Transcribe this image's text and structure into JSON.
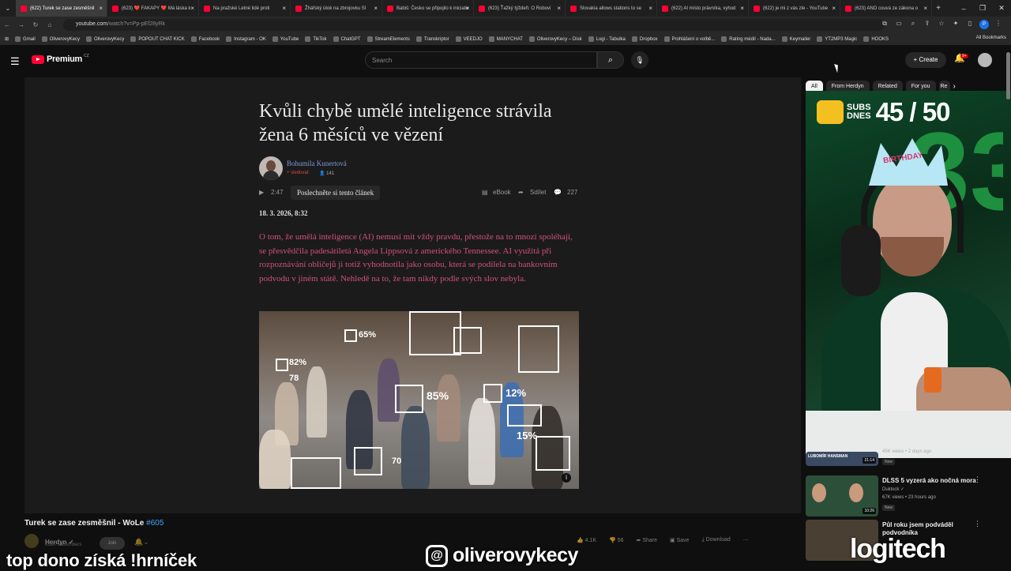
{
  "browser": {
    "tabs": [
      {
        "label": "(622) Turek se zase zesměšnil",
        "active": true
      },
      {
        "label": "(623) ❤️ FAKAPY ❤️ Má láska k",
        "active": false
      },
      {
        "label": "Na pražské Letné lidé proti",
        "active": false
      },
      {
        "label": "Žhářský útok na zbrojovku Sl",
        "active": false
      },
      {
        "label": "Babiš: Česko se připojilo k iniciativ",
        "active": false
      },
      {
        "label": "(623) Ťažký týždeň: O Robovi",
        "active": false
      },
      {
        "label": "Slovakia allows stations to se",
        "active": false
      },
      {
        "label": "(622) AI místo právníka, vyhod",
        "active": false
      },
      {
        "label": "(622) je mi z vás zle - YouTube",
        "active": false
      },
      {
        "label": "(623) ANO couvá ze zákona o",
        "active": false
      }
    ],
    "url_domain": "youtube.com",
    "url_path": "/watch?v=Pp-pEf28yRk",
    "bookmarks": [
      "Gmail",
      "OliverovyKecy",
      "OliverovyKecy",
      "POPOUT CHAT KICK",
      "Facebook",
      "Instagram - OK",
      "YouTube",
      "TikTok",
      "ChatGPT",
      "StreamElements",
      "Transkriptor",
      "VEEDJO",
      "MANYCHAT",
      "OliverovyKecy – Disk",
      "Logi - Tabulka",
      "Dropbox",
      "Prohlášení o volbě...",
      "Rating médií - Nada...",
      "Keymailer",
      "YT2MP3 Magic",
      "HOOKS"
    ],
    "all_bookmarks": "All Bookmarks",
    "profile_letter": "P"
  },
  "youtube": {
    "logo_text": "Premium",
    "logo_region": "CZ",
    "search_placeholder": "Search",
    "create_label": "Create",
    "notif_count": "9+",
    "chips": [
      "All",
      "From Herdyn",
      "Related",
      "For you",
      "Re"
    ]
  },
  "article": {
    "title": "Kvůli chybě umělé inteligence strávila žena 6 měsíců ve vězení",
    "author": "Bohumila Kunertová",
    "follow_label": "+ sledovat",
    "followers": "141",
    "audio_duration": "2:47",
    "listen_label": "Poslechněte si tento článek",
    "ebook_label": "eBook",
    "share_label": "Sdílet",
    "comments": "227",
    "date": "18. 3. 2026, 8:32",
    "lead": "O tom, že umělá inteligence (AI) nemusí mít vždy pravdu, přestože na to mnozí spoléhají, se přesvědčila padesátiletá Angela Lippsová z amerického Tennessee. AI využitá při rozpoznávání obličejů ji totiž vyhodnotila jako osobu, která se podílela na bankovním podvodu v jiném státě. Nehledě na to, že tam nikdy podle svých slov nebyla.",
    "photo_labels": [
      "65%",
      "82%",
      "78",
      "85%",
      "12%",
      "15%",
      "70"
    ],
    "photo_info": "i"
  },
  "webcam": {
    "subs_label_line1": "SUBS",
    "subs_label_line2": "DNES",
    "subs_count": "45 / 50",
    "balloon_number": "33",
    "hat_text": "BIRTHDAY"
  },
  "recommendations": [
    {
      "title": "",
      "channel": "",
      "meta": "45K views • 2 days ago",
      "new": "New",
      "duration": "21:14",
      "thumb_text": "LUBOMÍR HANSMAN",
      "thumb_color": "#3b4a63"
    },
    {
      "title": "DLSS 5 vyzerá ako nočná mora",
      "channel": "Duklock ✓",
      "meta": "67K views • 23 hours ago",
      "new": "New",
      "duration": "10:26",
      "thumb_text": "",
      "thumb_color": "#2c4f3a"
    },
    {
      "title": "Půl roku jsem podváděl podvodníka",
      "channel": "",
      "meta": "",
      "new": "",
      "duration": "",
      "thumb_text": "",
      "thumb_color": "#4a3f33"
    }
  ],
  "video": {
    "title": "Turek se zase zesměšnil - WoLe",
    "hashtag": "#605",
    "channel": "Herdyn ✓",
    "subs": "618K subscribers",
    "join_label": "Join",
    "likes": "4.1K",
    "dislike_label": "56",
    "share_label": "Share",
    "save_label": "Save",
    "download_label": "Download"
  },
  "overlay": {
    "bottom_left": "top dono získá !hrníček",
    "threads_glyph": "@",
    "handle": "oliverovykecy",
    "sponsor": "logitech"
  }
}
